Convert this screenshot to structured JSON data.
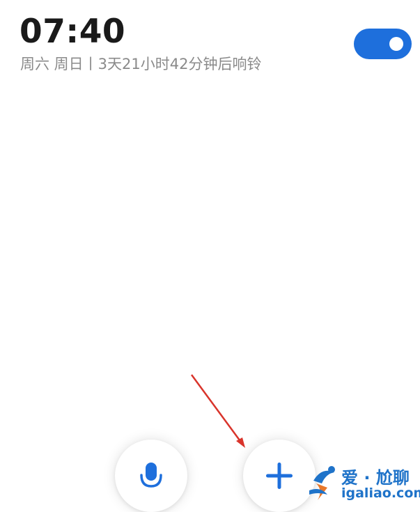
{
  "alarm": {
    "time": "07:40",
    "subtitle": "周六 周日丨3天21小时42分钟后响铃",
    "enabled": true
  },
  "colors": {
    "accent": "#1e6fdc",
    "annotation_arrow": "#d9342b",
    "watermark": "#1f73c9"
  },
  "buttons": {
    "voice_icon": "microphone-icon",
    "add_icon": "plus-icon"
  },
  "watermark": {
    "cn": "爱 · 尬聊",
    "url": "igaliao.com"
  }
}
